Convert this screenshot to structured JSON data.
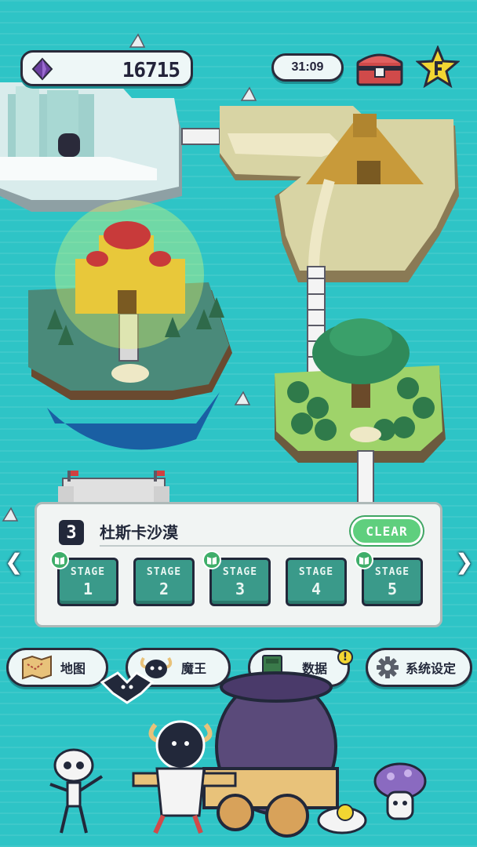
{
  "header": {
    "currency_value": "16715",
    "timer": "31:09"
  },
  "stage_panel": {
    "area_number": "3",
    "area_name": "杜斯卡沙漠",
    "clear_label": "CLEAR",
    "stages": [
      {
        "label": "STAGE",
        "number": "1",
        "has_book": true
      },
      {
        "label": "STAGE",
        "number": "2",
        "has_book": false
      },
      {
        "label": "STAGE",
        "number": "3",
        "has_book": true
      },
      {
        "label": "STAGE",
        "number": "4",
        "has_book": false
      },
      {
        "label": "STAGE",
        "number": "5",
        "has_book": true
      }
    ]
  },
  "nav": {
    "map": "地图",
    "demon_king": "魔王",
    "data": "数据",
    "settings": "系统设定",
    "data_notice": "!"
  },
  "colors": {
    "sea": "#2ec4c6",
    "stage_tile": "#3a9a8a",
    "clear_badge": "#5fcf7e",
    "gem": "#6b3fa0"
  }
}
